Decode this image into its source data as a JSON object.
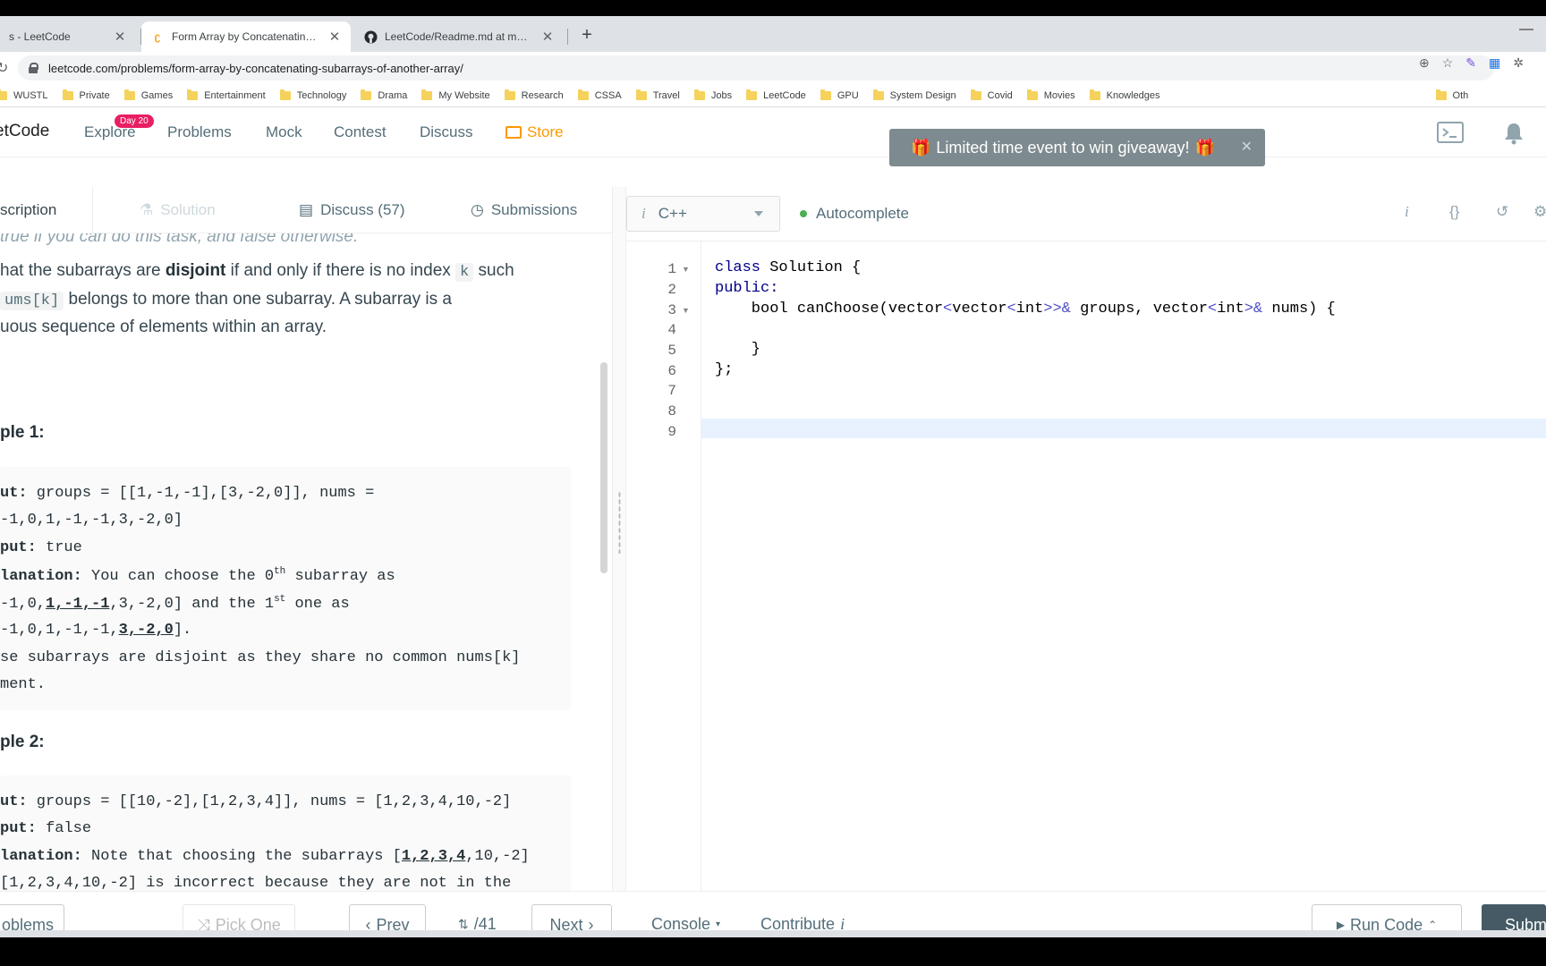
{
  "browser": {
    "tabs": [
      {
        "title": "s - LeetCode"
      },
      {
        "title": "Form Array by Concatenating Su"
      },
      {
        "title": "LeetCode/Readme.md at master"
      }
    ],
    "new_tab": "+",
    "url": "leetcode.com/problems/form-array-by-concatenating-subarrays-of-another-array/",
    "bookmarks": [
      "WUSTL",
      "Private",
      "Games",
      "Entertainment",
      "Technology",
      "Drama",
      "My Website",
      "Research",
      "CSSA",
      "Travel",
      "Jobs",
      "LeetCode",
      "GPU",
      "System Design",
      "Covid",
      "Movies",
      "Knowledges",
      "Oth"
    ]
  },
  "nav": {
    "logo": "etCode",
    "explore": "Explore",
    "day_badge": "Day 20",
    "problems": "Problems",
    "mock": "Mock",
    "contest": "Contest",
    "discuss": "Discuss",
    "store": "Store",
    "promo": "Limited time event to win giveaway!"
  },
  "panel_tabs": {
    "description": "scription",
    "solution": "Solution",
    "discuss": "Discuss (57)",
    "submissions": "Submissions"
  },
  "description": {
    "line0": "true if you can do this task, and false otherwise.",
    "line1_a": "hat the subarrays are ",
    "line1_b": "disjoint",
    "line1_c": " if and only if there is no index ",
    "line1_code": "k",
    "line1_d": " such",
    "line2_code": "ums[k]",
    "line2_b": " belongs to more than one subarray. A subarray is a",
    "line3": "uous sequence of elements within an array.",
    "example1_title": "ple 1:",
    "example2_title": "ple 2:"
  },
  "example1": {
    "input_label": "ut:",
    "input_text": " groups = [[1,-1,-1],[3,-2,0]], nums =",
    "input_cont": "-1,0,1,-1,-1,3,-2,0]",
    "output_label": "put:",
    "output_text": " true",
    "expl_label": "lanation:",
    "expl_text": " You can choose the 0",
    "sup_th": "th",
    "expl_text2": " subarray as",
    "l5_a": "-1,0,",
    "l5_u": "1,-1,-1",
    "l5_b": ",3,-2,0] and the 1",
    "sup_st": "st",
    "l5_c": " one as",
    "l6_a": "-1,0,1,-1,-1,",
    "l6_u": "3,-2,0",
    "l6_b": "].",
    "l7": "se subarrays are disjoint as they share no common nums[k]",
    "l8": "ment."
  },
  "example2": {
    "input_label": "ut:",
    "input_text": " groups = [[10,-2],[1,2,3,4]], nums = [1,2,3,4,10,-2]",
    "output_label": "put:",
    "output_text": " false",
    "expl_label": "lanation:",
    "expl_text": " Note that choosing the subarrays [",
    "expl_u": "1,2,3,4",
    "expl_text2": ",10,-2]",
    "l4": " [1,2,3,4,10,-2] is incorrect because they are not in the"
  },
  "editor": {
    "language": "C++",
    "autocomplete": "Autocomplete",
    "line_numbers": [
      "1",
      "2",
      "3",
      "4",
      "5",
      "6",
      "7",
      "8",
      "9"
    ],
    "code": {
      "l1_kw": "class",
      "l1_rest": " Solution {",
      "l2": "public:",
      "l3_a": "    bool canChoose(vector",
      "l3_b": "<",
      "l3_c": "vector",
      "l3_d": "<",
      "l3_e": "int",
      "l3_f": ">>&",
      "l3_g": " groups, vector",
      "l3_h": "<",
      "l3_i": "int",
      "l3_j": ">&",
      "l3_k": " nums) {",
      "l5": "    }",
      "l6": "};"
    }
  },
  "bottom": {
    "problems": "oblems",
    "pick_one": "Pick One",
    "prev": "Prev",
    "page": "/41",
    "next": "Next",
    "console": "Console",
    "contribute": "Contribute",
    "run_code": "Run Code",
    "submit": "Subm"
  }
}
